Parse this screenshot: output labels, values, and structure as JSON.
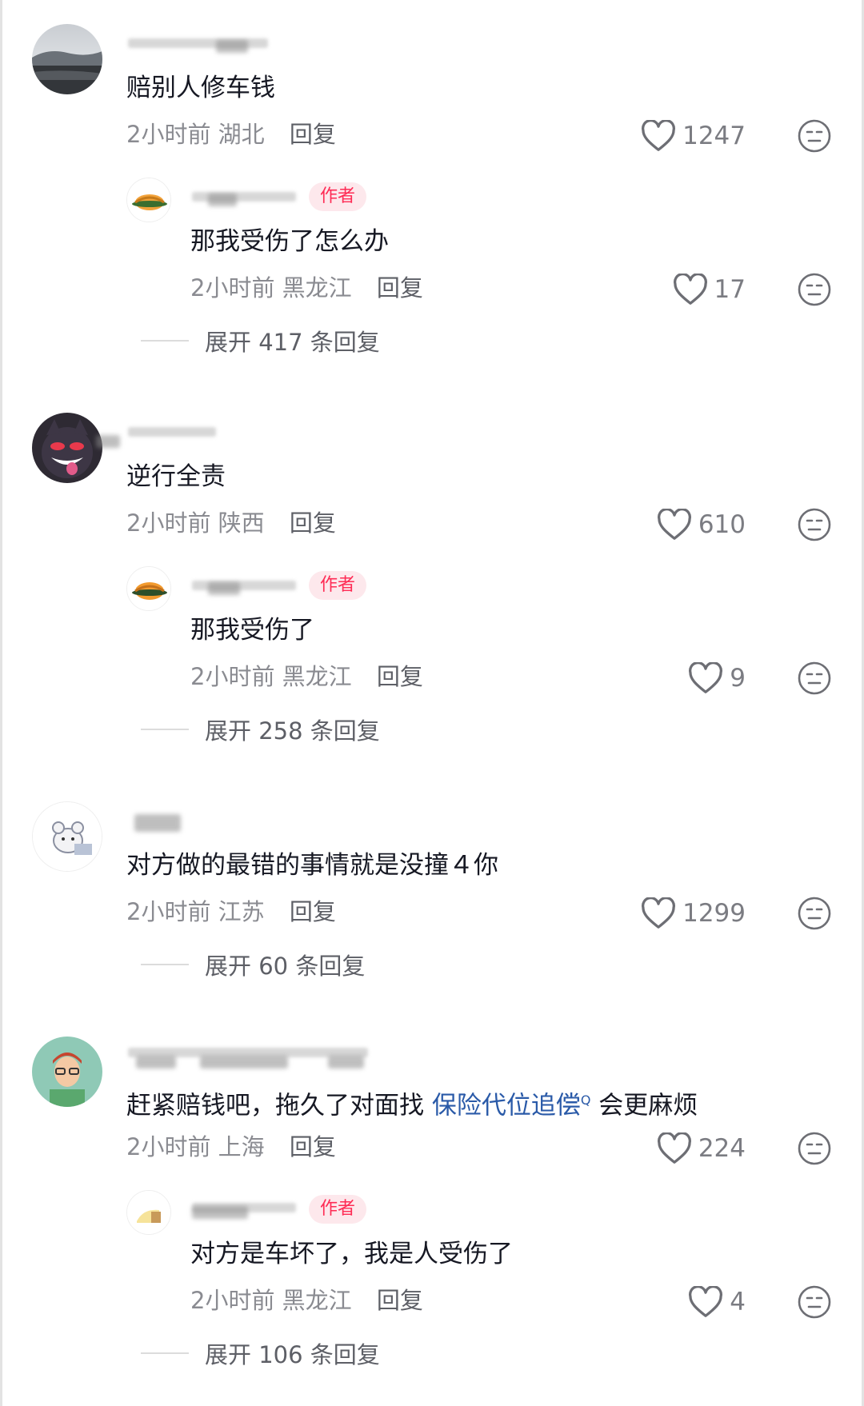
{
  "colors": {
    "author_badge_bg": "#fde8ec",
    "author_badge_text": "#fe2c55",
    "link": "#2a5aa8",
    "meta": "#8a8b91"
  },
  "icons": {
    "like": "heart-outline-icon",
    "dislike": "neutral-face-icon"
  },
  "comments": [
    {
      "text": "赔别人修车钱",
      "time": "2小时前",
      "location": "湖北",
      "reply_label": "回复",
      "likes": "1247",
      "reply": {
        "author_badge": "作者",
        "text": "那我受伤了怎么办",
        "time": "2小时前",
        "location": "黑龙江",
        "reply_label": "回复",
        "likes": "17"
      },
      "expand_label": "展开 417 条回复"
    },
    {
      "text": "逆行全责",
      "time": "2小时前",
      "location": "陕西",
      "reply_label": "回复",
      "likes": "610",
      "reply": {
        "author_badge": "作者",
        "text": "那我受伤了",
        "time": "2小时前",
        "location": "黑龙江",
        "reply_label": "回复",
        "likes": "9"
      },
      "expand_label": "展开 258 条回复"
    },
    {
      "text": "对方做的最错的事情就是没撞４你",
      "time": "2小时前",
      "location": "江苏",
      "reply_label": "回复",
      "likes": "1299",
      "expand_label": "展开 60 条回复"
    },
    {
      "text_before": "赶紧赔钱吧，拖久了对面找 ",
      "text_link": "保险代位追偿",
      "text_link_mark": "Q",
      "text_after": " 会更麻烦",
      "time": "2小时前",
      "location": "上海",
      "reply_label": "回复",
      "likes": "224",
      "reply": {
        "author_badge": "作者",
        "text": "对方是车坏了，我是人受伤了",
        "time": "2小时前",
        "location": "黑龙江",
        "reply_label": "回复",
        "likes": "4"
      },
      "expand_label": "展开 106 条回复"
    }
  ]
}
